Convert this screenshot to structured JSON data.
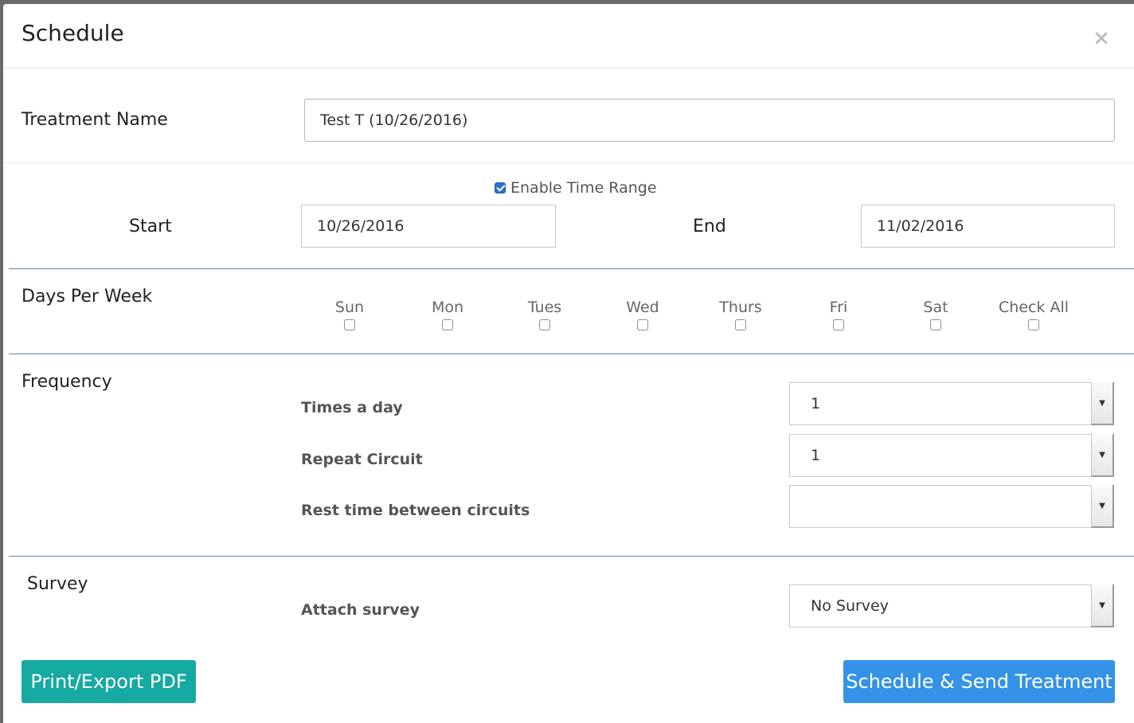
{
  "modal": {
    "title": "Schedule",
    "close_glyph": "×"
  },
  "treatment": {
    "label": "Treatment Name",
    "value": "Test T (10/26/2016)"
  },
  "time_range": {
    "enable_label": "Enable Time Range",
    "enabled": true,
    "start_label": "Start",
    "start_value": "10/26/2016",
    "end_label": "End",
    "end_value": "11/02/2016"
  },
  "days": {
    "label": "Days Per Week",
    "items": [
      {
        "label": "Sun",
        "checked": false
      },
      {
        "label": "Mon",
        "checked": false
      },
      {
        "label": "Tues",
        "checked": false
      },
      {
        "label": "Wed",
        "checked": false
      },
      {
        "label": "Thurs",
        "checked": false
      },
      {
        "label": "Fri",
        "checked": false
      },
      {
        "label": "Sat",
        "checked": false
      },
      {
        "label": "Check All",
        "checked": false
      }
    ]
  },
  "frequency": {
    "label": "Frequency",
    "times_a_day_label": "Times a day",
    "times_a_day_value": "1",
    "repeat_circuit_label": "Repeat Circuit",
    "repeat_circuit_value": "1",
    "rest_time_label": "Rest time between circuits",
    "rest_time_value": ""
  },
  "survey": {
    "label": "Survey",
    "attach_label": "Attach survey",
    "attach_value": "No Survey"
  },
  "buttons": {
    "print_label": "Print/Export PDF",
    "schedule_label": "Schedule & Send Treatment"
  },
  "colors": {
    "teal_button": "#17aaa3",
    "blue_button": "#3493e6",
    "divider_blue": "#5e86a0"
  }
}
